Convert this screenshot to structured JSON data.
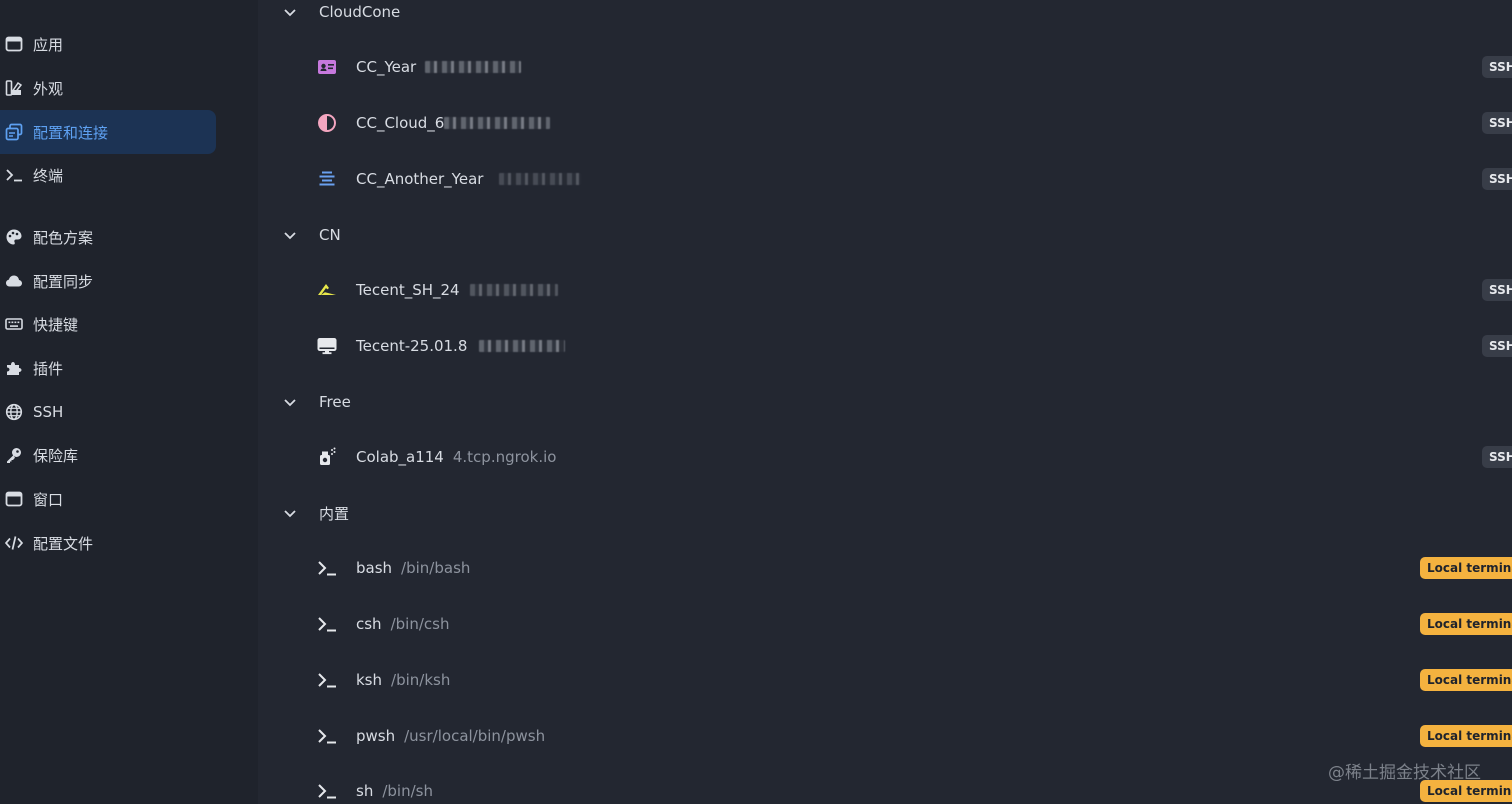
{
  "sidebar": {
    "items": [
      {
        "label": "应用",
        "icon": "window-icon",
        "active": false
      },
      {
        "label": "外观",
        "icon": "appearance-icon",
        "active": false
      },
      {
        "label": "配置和连接",
        "icon": "profiles-icon",
        "active": true
      },
      {
        "label": "终端",
        "icon": "terminal-icon",
        "active": false
      },
      {
        "label": "配色方案",
        "icon": "palette-icon",
        "active": false
      },
      {
        "label": "配置同步",
        "icon": "cloud-icon",
        "active": false
      },
      {
        "label": "快捷键",
        "icon": "keyboard-icon",
        "active": false
      },
      {
        "label": "插件",
        "icon": "puzzle-icon",
        "active": false
      },
      {
        "label": "SSH",
        "icon": "globe-icon",
        "active": false
      },
      {
        "label": "保险库",
        "icon": "key-icon",
        "active": false
      },
      {
        "label": "窗口",
        "icon": "window-icon",
        "active": false
      },
      {
        "label": "配置文件",
        "icon": "code-icon",
        "active": false
      }
    ]
  },
  "groups": [
    {
      "name": "CloudCone",
      "profiles": [
        {
          "name": "CC_Year",
          "detail": "",
          "icon": "id-card-icon",
          "icon_color": "#c678dd",
          "badge": "SSH"
        },
        {
          "name": "CC_Cloud_6",
          "detail": "",
          "icon": "half-circle-icon",
          "icon_color": "#f4a6c0",
          "badge": "SSH"
        },
        {
          "name": "CC_Another_Year",
          "detail": "",
          "icon": "align-center-icon",
          "icon_color": "#6aa0f0",
          "badge": "SSH"
        }
      ]
    },
    {
      "name": "CN",
      "profiles": [
        {
          "name": "Tecent_SH_24",
          "detail": "",
          "icon": "arrow-logo-icon",
          "icon_color": "#e8e84a",
          "badge": "SSH"
        },
        {
          "name": "Tecent-25.01.8",
          "detail": "",
          "icon": "monitor-icon",
          "icon_color": "#e6e8ec",
          "badge": "SSH"
        }
      ]
    },
    {
      "name": "Free",
      "profiles": [
        {
          "name": "Colab_a114",
          "detail": "4.tcp.ngrok.io",
          "icon": "spray-icon",
          "icon_color": "#e6e8ec",
          "badge": "SSH"
        }
      ]
    },
    {
      "name": "内置",
      "profiles": [
        {
          "name": "bash",
          "detail": "/bin/bash",
          "icon": "terminal-icon",
          "icon_color": "#e6e8ec",
          "badge": "Local terminal"
        },
        {
          "name": "csh",
          "detail": "/bin/csh",
          "icon": "terminal-icon",
          "icon_color": "#e6e8ec",
          "badge": "Local terminal"
        },
        {
          "name": "ksh",
          "detail": "/bin/ksh",
          "icon": "terminal-icon",
          "icon_color": "#e6e8ec",
          "badge": "Local terminal"
        },
        {
          "name": "pwsh",
          "detail": "/usr/local/bin/pwsh",
          "icon": "terminal-icon",
          "icon_color": "#e6e8ec",
          "badge": "Local terminal"
        },
        {
          "name": "sh",
          "detail": "/bin/sh",
          "icon": "terminal-icon",
          "icon_color": "#e6e8ec",
          "badge": "Local terminal"
        }
      ]
    }
  ],
  "watermark": "@稀土掘金技术社区",
  "colors": {
    "background": "#232731",
    "sidebar": "#1f232c",
    "active_bg": "#1c3354",
    "active_text": "#5ea1f2",
    "local_badge": "#f4b23f",
    "ssh_badge": "#383d48"
  }
}
